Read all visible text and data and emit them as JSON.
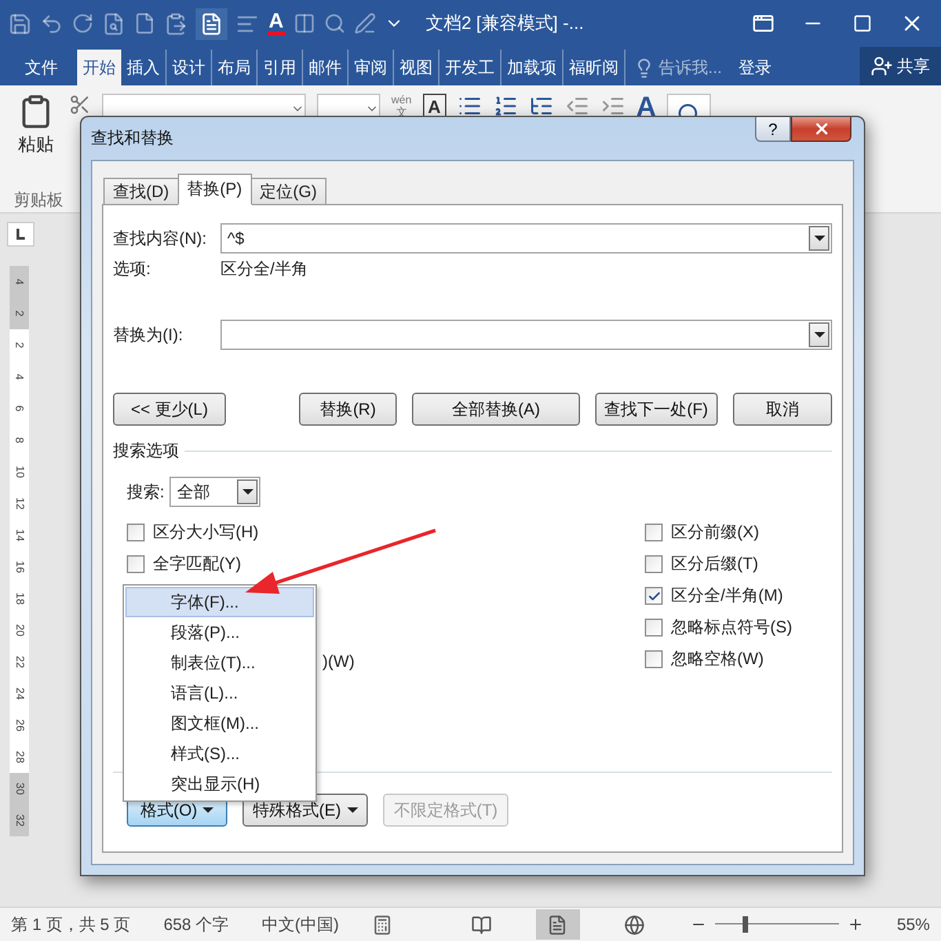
{
  "app_window": {
    "title": "文档2 [兼容模式] -...",
    "font_color_glyph": "A"
  },
  "ribbon_tabs": [
    {
      "label": "文件",
      "selected": false
    },
    {
      "label": "开始",
      "selected": true
    },
    {
      "label": "插入",
      "selected": false
    },
    {
      "label": "设计",
      "selected": false
    },
    {
      "label": "布局",
      "selected": false
    },
    {
      "label": "引用",
      "selected": false
    },
    {
      "label": "邮件",
      "selected": false
    },
    {
      "label": "审阅",
      "selected": false
    },
    {
      "label": "视图",
      "selected": false
    },
    {
      "label": "开发工",
      "selected": false
    },
    {
      "label": "加载项",
      "selected": false
    },
    {
      "label": "福昕阅",
      "selected": false
    }
  ],
  "tell_me": {
    "placeholder": "告诉我..."
  },
  "sign_in": "登录",
  "share": "共享",
  "ribbon": {
    "paste": "粘贴",
    "clipboard_group": "剪贴板",
    "phonetic_top": "wén",
    "phonetic_bottom": "文",
    "char_border": "A",
    "styles_glyph": "A"
  },
  "ruler": {
    "labels": [
      {
        "label": "4",
        "margin": true
      },
      {
        "label": "2",
        "margin": true
      },
      {
        "label": "2",
        "margin": false
      },
      {
        "label": "4",
        "margin": false
      },
      {
        "label": "6",
        "margin": false
      },
      {
        "label": "8",
        "margin": false
      },
      {
        "label": "10",
        "margin": false
      },
      {
        "label": "12",
        "margin": false
      },
      {
        "label": "14",
        "margin": false
      },
      {
        "label": "16",
        "margin": false
      },
      {
        "label": "18",
        "margin": false
      },
      {
        "label": "20",
        "margin": false
      },
      {
        "label": "22",
        "margin": false
      },
      {
        "label": "24",
        "margin": false
      },
      {
        "label": "26",
        "margin": false
      },
      {
        "label": "28",
        "margin": false
      },
      {
        "label": "30",
        "margin": true
      },
      {
        "label": "32",
        "margin": true
      }
    ]
  },
  "dialog": {
    "title": "查找和替换",
    "help": "?",
    "tabs": [
      {
        "label": "查找(D)",
        "selected": false
      },
      {
        "label": "替换(P)",
        "selected": true
      },
      {
        "label": "定位(G)",
        "selected": false
      }
    ],
    "find": {
      "label": "查找内容(N):",
      "value": "^$"
    },
    "options_label": "选项:",
    "options_value": "区分全/半角",
    "replace": {
      "label": "替换为(I):"
    },
    "buttons": [
      {
        "label": "<< 更少(L)",
        "kind": "toggle"
      },
      {
        "label": "替换(R)",
        "kind": "action"
      },
      {
        "label": "全部替换(A)",
        "kind": "action"
      },
      {
        "label": "查找下一处(F)",
        "kind": "action"
      },
      {
        "label": "取消",
        "kind": "action"
      }
    ],
    "search_options_label": "搜索选项",
    "search": {
      "label": "搜索:",
      "value": "全部"
    },
    "left_options": [
      {
        "label": "区分大小写(H)",
        "checked": false
      },
      {
        "label": "全字匹配(Y)",
        "checked": false
      }
    ],
    "covered_option_tail": ")(W)",
    "right_options": [
      {
        "label": "区分前缀(X)",
        "checked": false
      },
      {
        "label": "区分后缀(T)",
        "checked": false
      },
      {
        "label": "区分全/半角(M)",
        "checked": true
      },
      {
        "label": "忽略标点符号(S)",
        "checked": false
      },
      {
        "label": "忽略空格(W)",
        "checked": false
      }
    ],
    "format_buttons": [
      {
        "label": "格式(O)",
        "kind": "pressed"
      },
      {
        "label": "特殊格式(E)",
        "kind": "normal"
      },
      {
        "label": "不限定格式(T)",
        "kind": "disabled"
      }
    ]
  },
  "format_menu": {
    "items": [
      {
        "label": "字体(F)...",
        "selected": true
      },
      {
        "label": "段落(P)...",
        "selected": false
      },
      {
        "label": "制表位(T)...",
        "selected": false
      },
      {
        "label": "语言(L)...",
        "selected": false
      },
      {
        "label": "图文框(M)...",
        "selected": false
      },
      {
        "label": "样式(S)...",
        "selected": false
      },
      {
        "label": "突出显示(H)",
        "selected": false
      }
    ]
  },
  "status_bar": {
    "page": "第 1 页，共 5 页",
    "words": "658 个字",
    "language": "中文(中国)",
    "zoom": {
      "reading": "55%",
      "level": 0.25
    }
  }
}
